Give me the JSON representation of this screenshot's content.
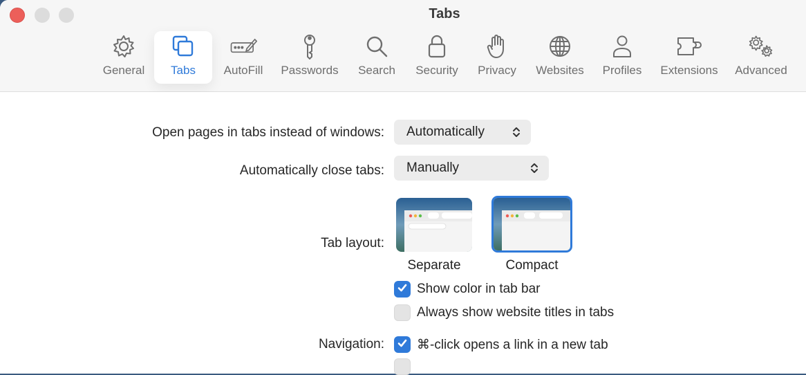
{
  "window": {
    "title": "Tabs"
  },
  "toolbar": {
    "items": [
      {
        "label": "General",
        "icon": "gear-icon"
      },
      {
        "label": "Tabs",
        "icon": "tabs-icon"
      },
      {
        "label": "AutoFill",
        "icon": "pencil-field-icon"
      },
      {
        "label": "Passwords",
        "icon": "key-icon"
      },
      {
        "label": "Search",
        "icon": "magnifier-icon"
      },
      {
        "label": "Security",
        "icon": "lock-icon"
      },
      {
        "label": "Privacy",
        "icon": "hand-icon"
      },
      {
        "label": "Websites",
        "icon": "globe-icon"
      },
      {
        "label": "Profiles",
        "icon": "person-icon"
      },
      {
        "label": "Extensions",
        "icon": "puzzle-icon"
      },
      {
        "label": "Advanced",
        "icon": "gears-icon"
      }
    ],
    "active": "Tabs"
  },
  "settings": {
    "open_pages": {
      "label": "Open pages in tabs instead of windows:",
      "value": "Automatically"
    },
    "close_tabs": {
      "label": "Automatically close tabs:",
      "value": "Manually"
    },
    "tab_layout": {
      "label": "Tab layout:",
      "options": [
        {
          "label": "Separate",
          "selected": false
        },
        {
          "label": "Compact",
          "selected": true
        }
      ]
    },
    "show_color": {
      "label": "Show color in tab bar",
      "checked": true
    },
    "show_titles": {
      "label": "Always show website titles in tabs",
      "checked": false
    },
    "navigation": {
      "label": "Navigation:",
      "option": "⌘-click opens a link in a new tab",
      "checked": true
    }
  },
  "colors": {
    "accent": "#2f7ad9",
    "close": "#ec5f5a"
  }
}
